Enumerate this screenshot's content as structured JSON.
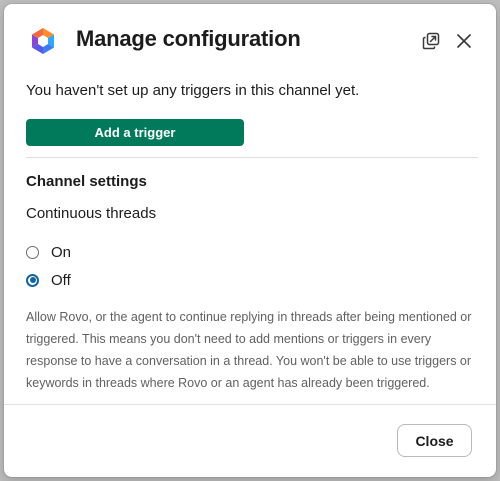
{
  "modal": {
    "title": "Manage configuration",
    "app_logo_icon": "rovo-logo-icon",
    "header_icons": [
      "open-in-new-window-icon",
      "close-icon"
    ]
  },
  "triggers": {
    "empty_message": "You haven't set up any triggers in this channel yet.",
    "add_button_label": "Add a trigger",
    "add_button_color": "#007a5a"
  },
  "channel_settings": {
    "heading": "Channel settings",
    "setting_label": "Continuous threads",
    "options": [
      {
        "label": "On",
        "selected": false
      },
      {
        "label": "Off",
        "selected": true
      }
    ],
    "radio_accent_color": "#1264a3",
    "description": "Allow Rovo, or the agent to continue replying in threads after being mentioned or triggered. This means you don't need to add mentions or triggers in every response to have a conversation in a thread. You won't be able to use triggers or keywords in threads where Rovo or an agent has already been triggered."
  },
  "footer": {
    "close_label": "Close"
  }
}
